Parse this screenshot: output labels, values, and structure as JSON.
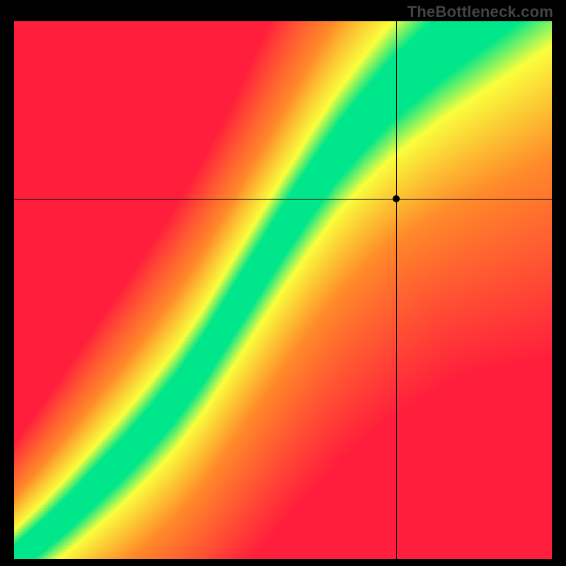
{
  "watermark": "TheBottleneck.com",
  "chart_data": {
    "type": "heatmap",
    "title": "",
    "xlabel": "",
    "ylabel": "",
    "xlim": [
      0,
      1
    ],
    "ylim": [
      0,
      1
    ],
    "crosshair": {
      "x": 0.71,
      "y": 0.67
    },
    "marker": {
      "x": 0.71,
      "y": 0.67
    },
    "optimal_curve": [
      {
        "x": 0.0,
        "y": 0.0
      },
      {
        "x": 0.05,
        "y": 0.04
      },
      {
        "x": 0.1,
        "y": 0.085
      },
      {
        "x": 0.15,
        "y": 0.135
      },
      {
        "x": 0.2,
        "y": 0.185
      },
      {
        "x": 0.25,
        "y": 0.24
      },
      {
        "x": 0.3,
        "y": 0.3
      },
      {
        "x": 0.35,
        "y": 0.37
      },
      {
        "x": 0.4,
        "y": 0.45
      },
      {
        "x": 0.45,
        "y": 0.53
      },
      {
        "x": 0.5,
        "y": 0.61
      },
      {
        "x": 0.55,
        "y": 0.685
      },
      {
        "x": 0.6,
        "y": 0.755
      },
      {
        "x": 0.65,
        "y": 0.815
      },
      {
        "x": 0.7,
        "y": 0.87
      },
      {
        "x": 0.75,
        "y": 0.915
      },
      {
        "x": 0.8,
        "y": 0.96
      },
      {
        "x": 0.85,
        "y": 1.0
      }
    ],
    "color_stops": {
      "optimal": "#00e68a",
      "near": "#faff3d",
      "mid": "#ff8a2a",
      "far": "#ff1e3c"
    }
  }
}
